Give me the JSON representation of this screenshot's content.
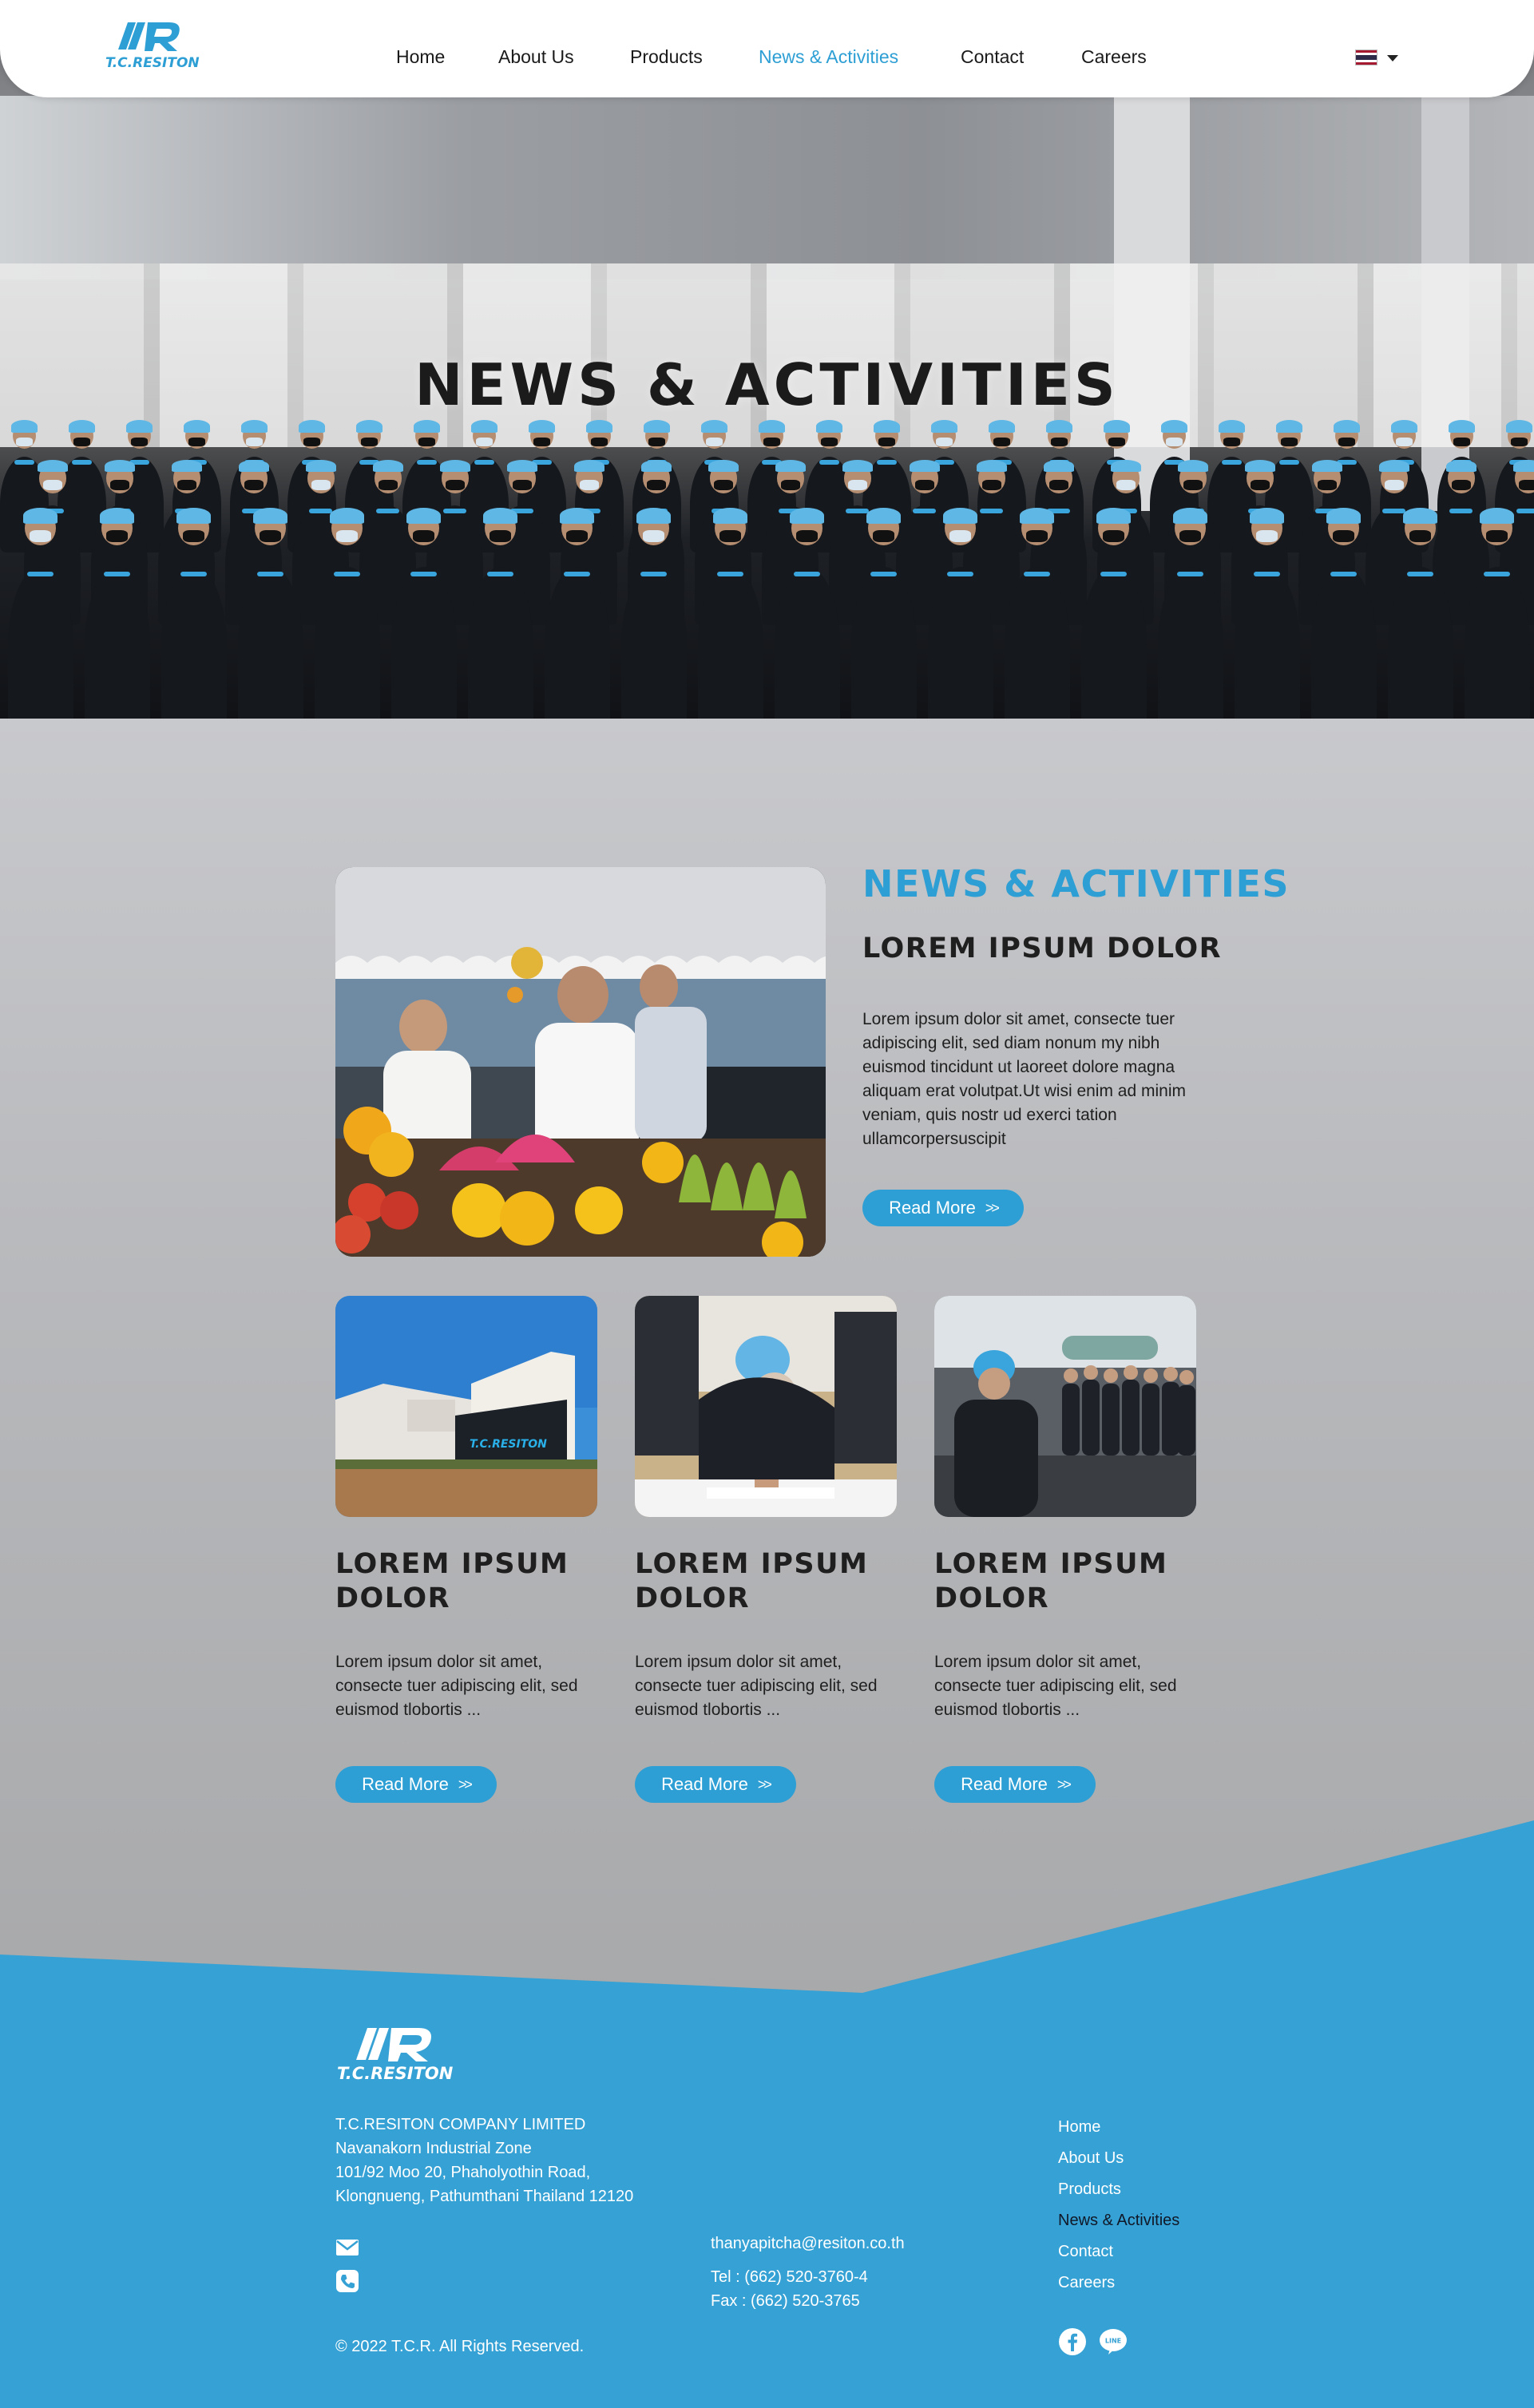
{
  "brand": {
    "name": "T.C.RESITON"
  },
  "nav": {
    "items": [
      {
        "label": "Home",
        "active": false
      },
      {
        "label": "About Us",
        "active": false
      },
      {
        "label": "Products",
        "active": false
      },
      {
        "label": "News & Activities",
        "active": true
      },
      {
        "label": "Contact",
        "active": false
      },
      {
        "label": "Careers",
        "active": false
      }
    ],
    "language": "Thai flag"
  },
  "hero": {
    "title": "NEWS & ACTIVITIES"
  },
  "featured": {
    "section_title": "NEWS & ACTIVITIES",
    "heading": "LOREM IPSUM DOLOR",
    "text": "Lorem ipsum dolor sit amet, consecte tuer adipiscing elit, sed diam nonum my nibh euismod tincidunt ut laoreet dolore magna aliquam erat volutpat.Ut wisi enim ad minim veniam, quis nostr ud exerci tation ullamcorpersuscipit",
    "button": "Read More"
  },
  "cards": [
    {
      "title": "LOREM IPSUM DOLOR",
      "text": "Lorem ipsum dolor sit amet, consecte tuer adipiscing elit, sed euismod tlobortis ...",
      "button": "Read More"
    },
    {
      "title": "LOREM IPSUM DOLOR",
      "text": "Lorem ipsum dolor sit amet, consecte tuer adipiscing elit, sed euismod tlobortis ...",
      "button": "Read More"
    },
    {
      "title": "LOREM IPSUM DOLOR",
      "text": "Lorem ipsum dolor sit amet, consecte tuer adipiscing elit, sed euismod tlobortis ...",
      "button": "Read More"
    }
  ],
  "footer": {
    "company": "T.C.RESITON COMPANY LIMITED",
    "address_lines": [
      "Navanakorn Industrial Zone",
      "101/92 Moo 20, Phaholyothin Road,",
      "Klongnueng, Pathumthani Thailand 12120"
    ],
    "email": "thanyapitcha@resiton.co.th",
    "tel": "Tel  : (662) 520-3760-4",
    "fax": "Fax : (662) 520-3765",
    "copyright": "© 2022 T.C.R. All Rights Reserved.",
    "links": [
      "Home",
      "About Us",
      "Products",
      "News & Activities",
      "Contact",
      "Careers"
    ],
    "social": [
      "facebook-icon",
      "line-icon"
    ],
    "line_label": "LINE"
  },
  "colors": {
    "accent": "#2e9fd4",
    "footer": "#35a1d4",
    "text": "#1f1f1f"
  }
}
